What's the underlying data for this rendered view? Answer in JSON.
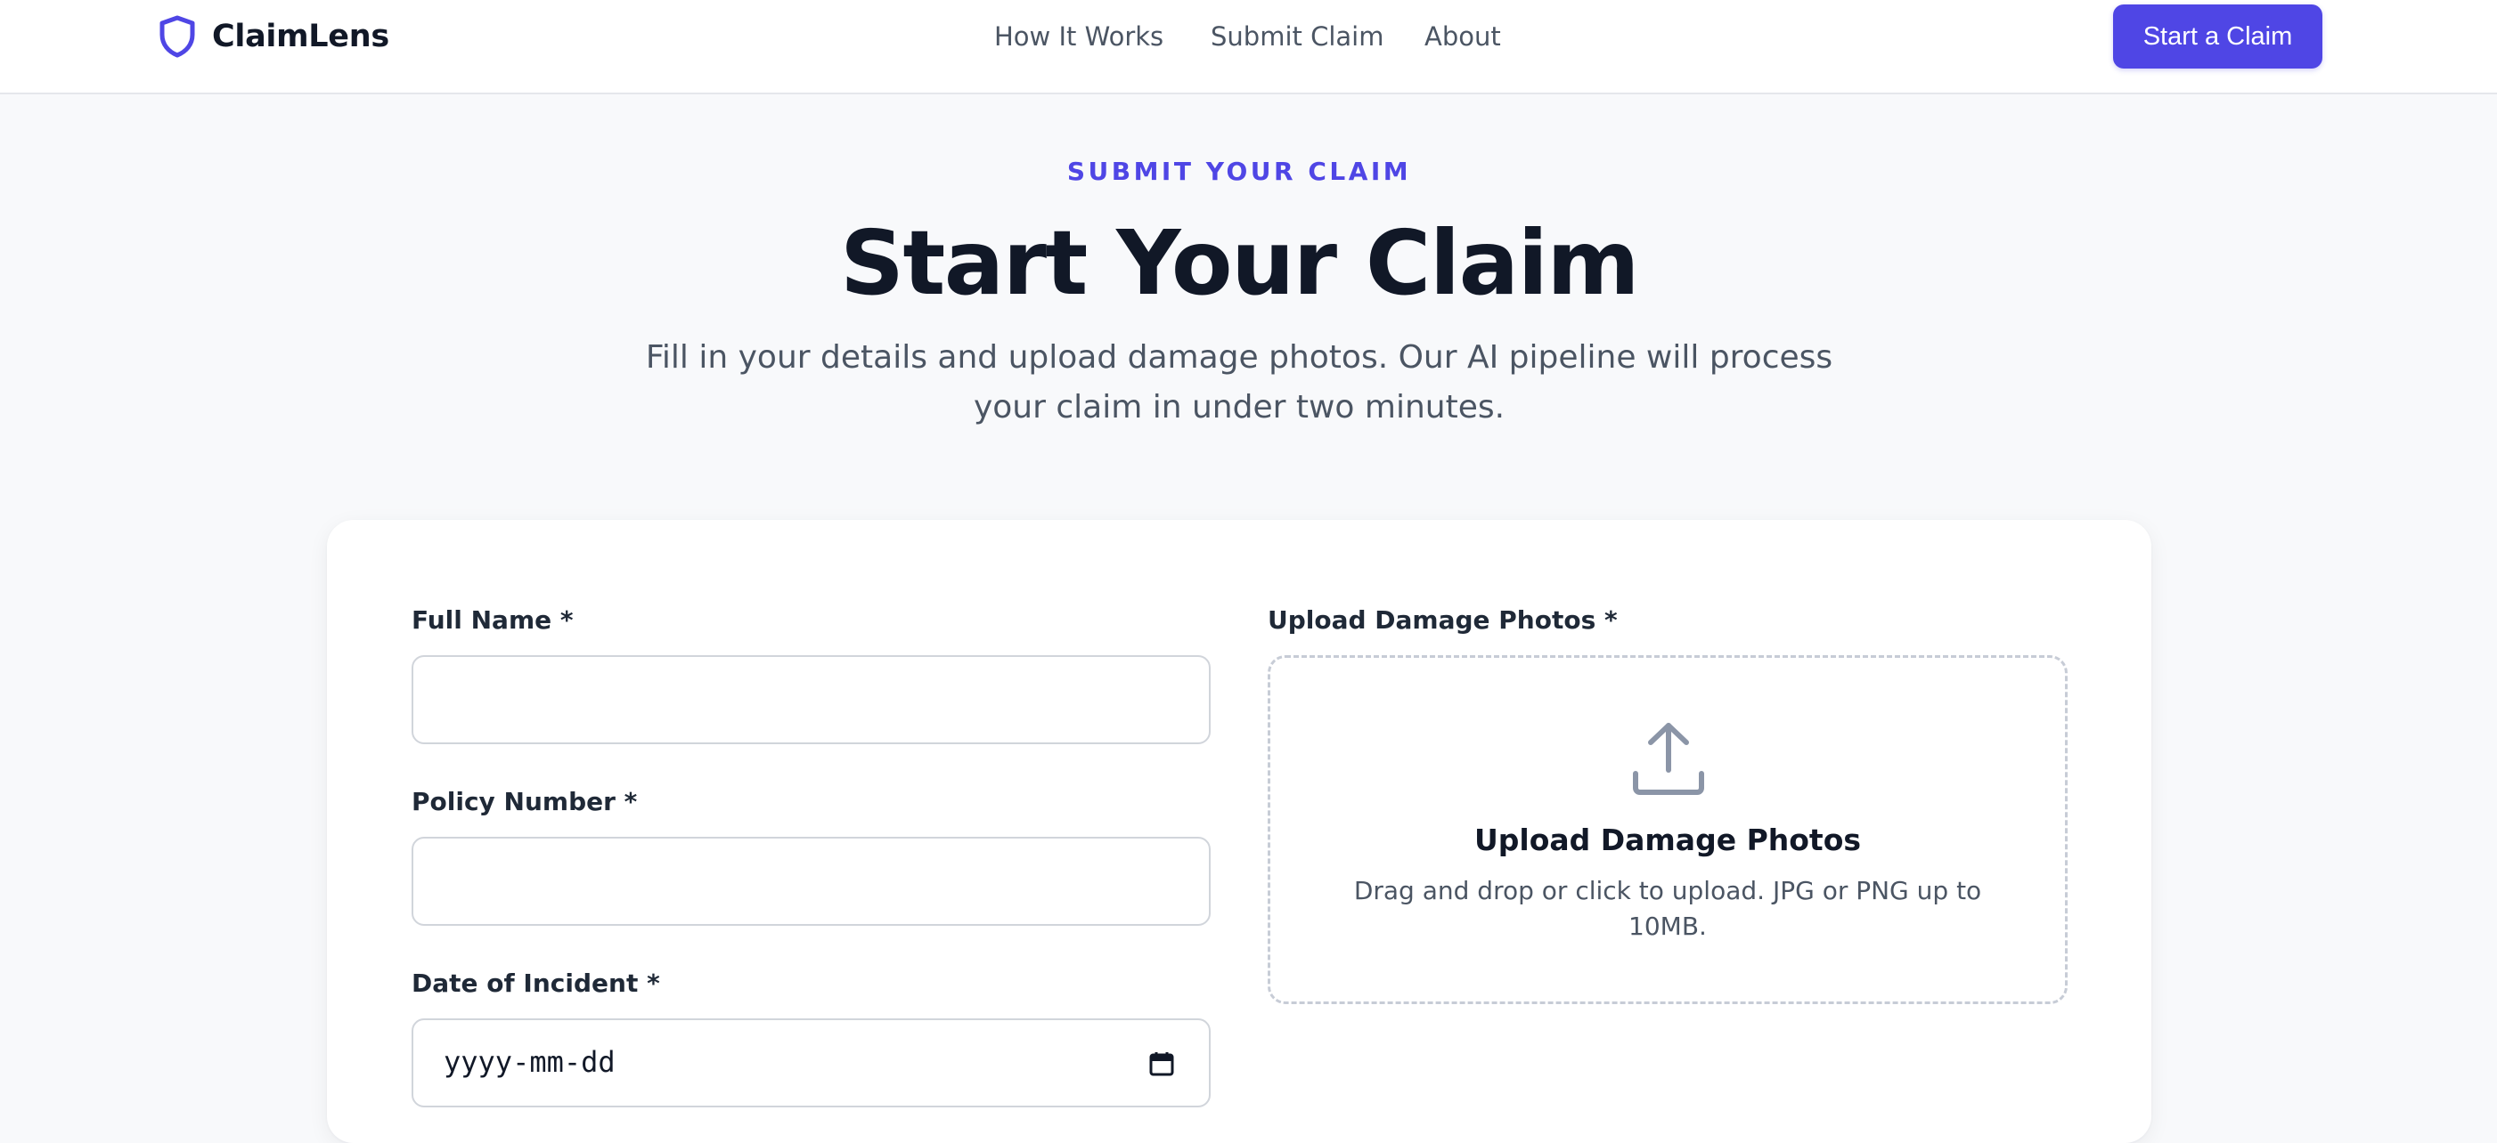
{
  "brand": {
    "name": "ClaimLens",
    "icon": "shield-icon"
  },
  "nav": {
    "links": [
      "How It Works",
      "Submit Claim",
      "About"
    ],
    "cta": "Start a Claim"
  },
  "hero": {
    "eyebrow": "SUBMIT YOUR CLAIM",
    "title": "Start Your Claim",
    "subtitle": "Fill in your details and upload damage photos. Our AI pipeline will process your claim in under two minutes."
  },
  "form": {
    "full_name": {
      "label": "Full Name *",
      "value": "",
      "placeholder": ""
    },
    "policy_number": {
      "label": "Policy Number *",
      "value": "",
      "placeholder": ""
    },
    "date_of_incident": {
      "label": "Date of Incident *",
      "placeholder": "yyyy-mm-dd",
      "icon": "calendar-icon"
    },
    "upload": {
      "label": "Upload Damage Photos *",
      "icon": "upload-icon",
      "title": "Upload Damage Photos",
      "description": "Drag and drop or click to upload. JPG or PNG up to 10MB."
    }
  },
  "colors": {
    "accent": "#4f46e5",
    "background": "#f8f9fb",
    "text_primary": "#111827",
    "text_secondary": "#4b5563",
    "border": "#d1d5db"
  }
}
